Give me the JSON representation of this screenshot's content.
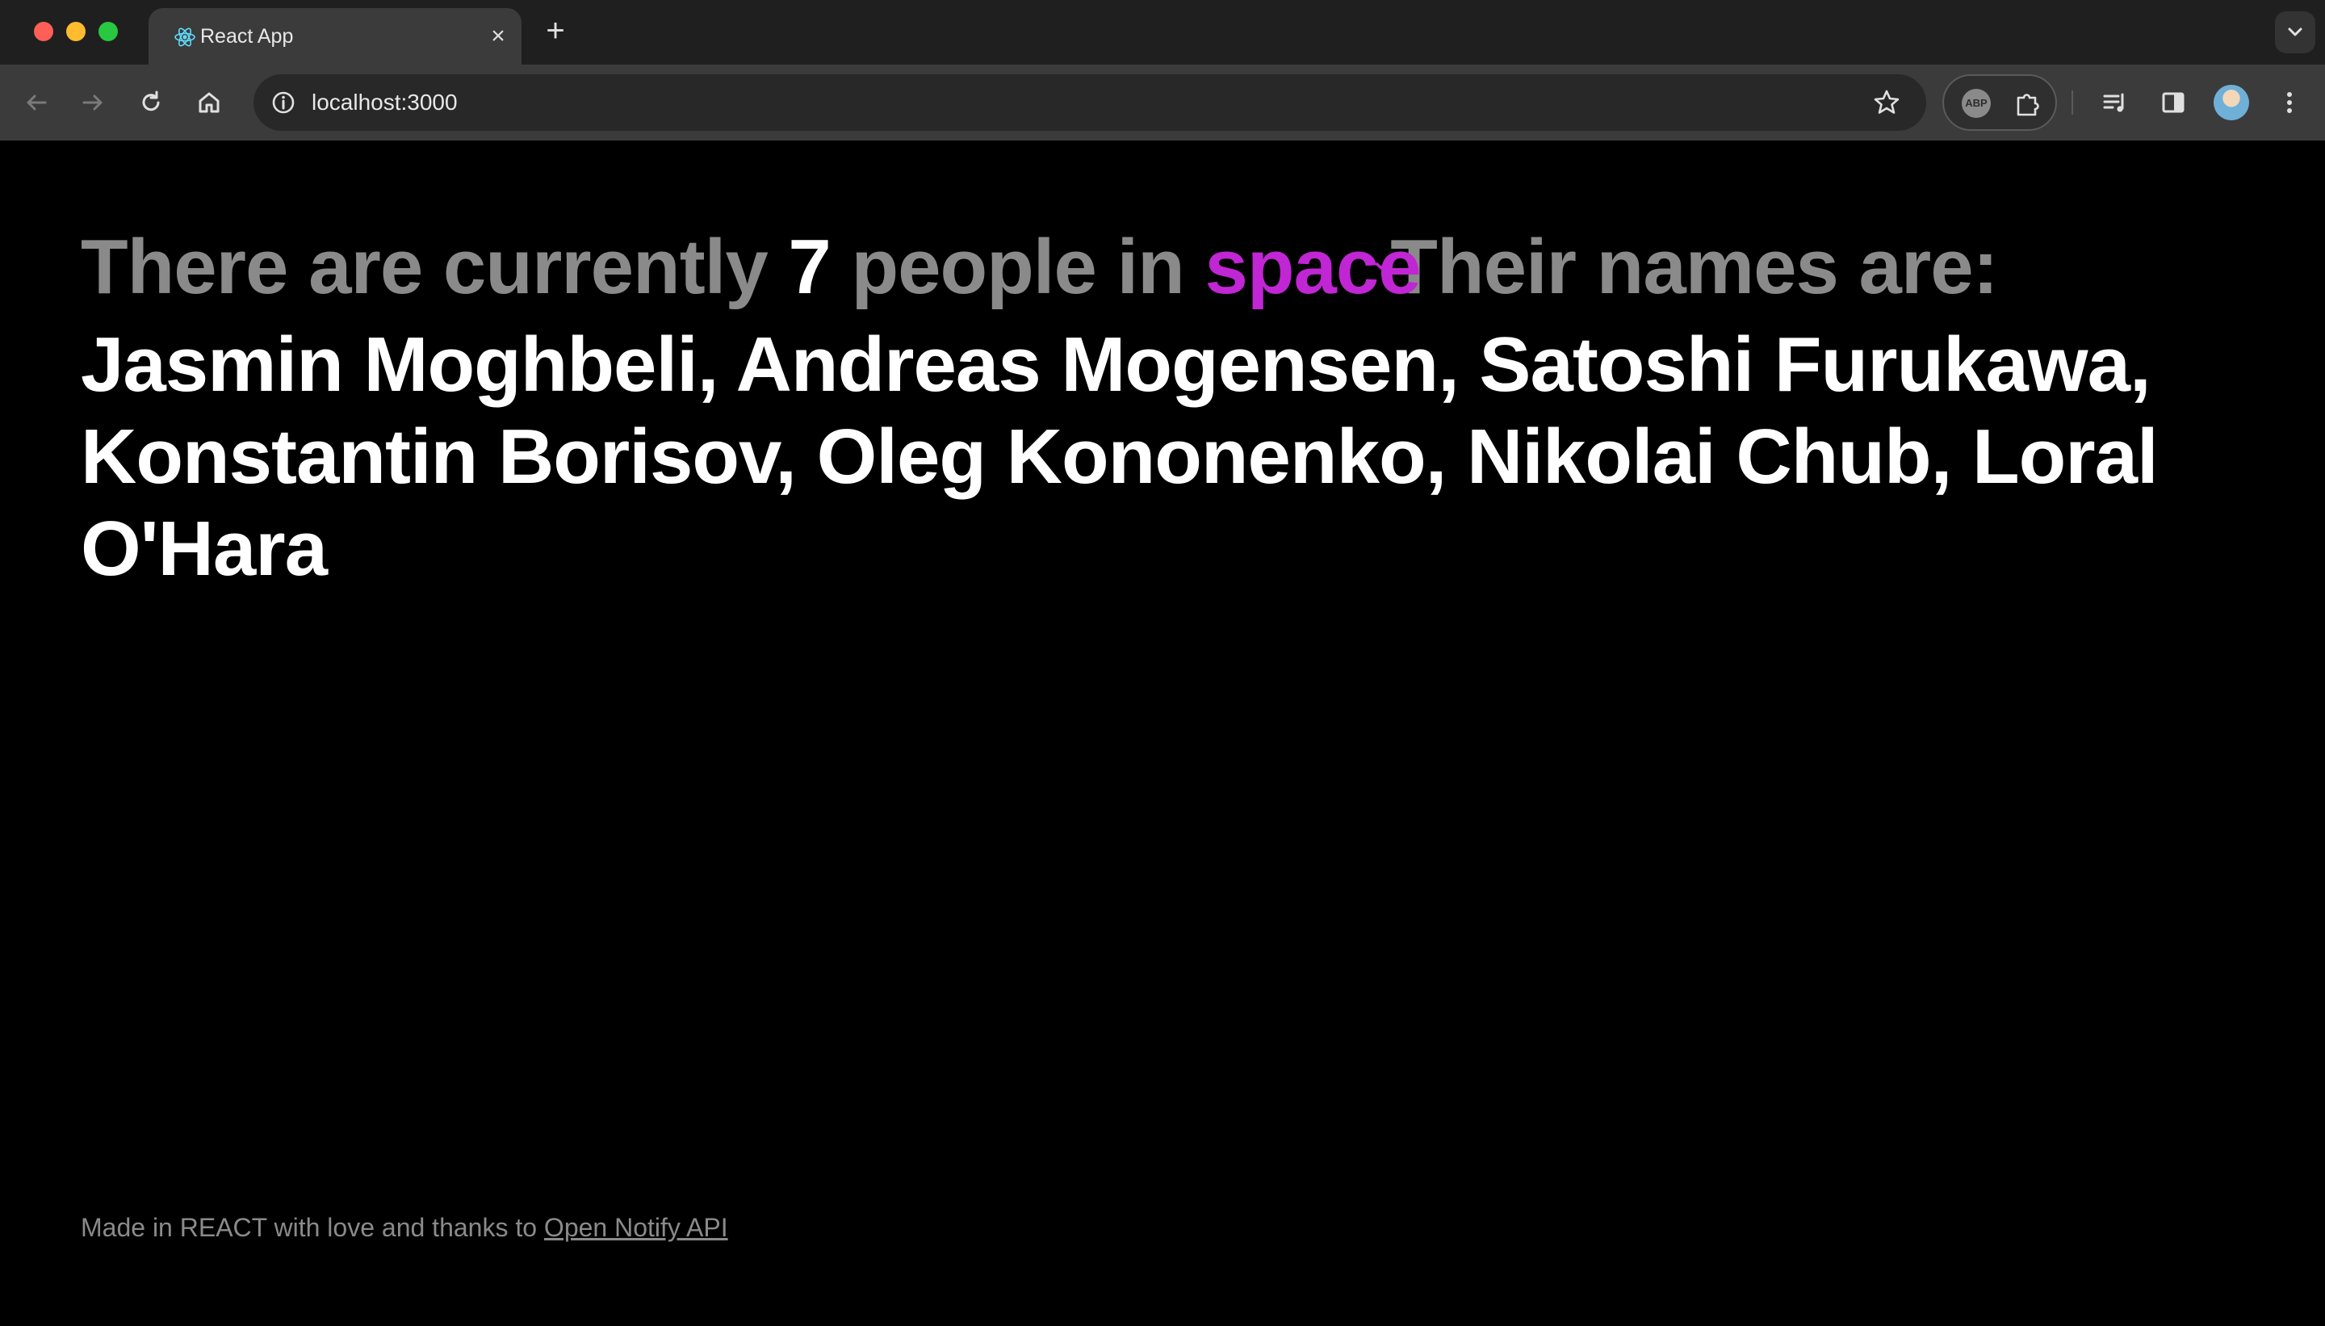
{
  "browser": {
    "tab_title": "React App",
    "tab_close": "×",
    "new_tab": "+",
    "url": "localhost:3000",
    "extension_label": "ABP"
  },
  "page": {
    "prefix": "There are currently",
    "count": "7",
    "middle": "people in",
    "location_selected": "space",
    "suffix": "Their names are:",
    "names": "Jasmin Moghbeli, Andreas Mogensen, Satoshi Furukawa, Konstantin Borisov, Oleg Kononenko, Nikolai Chub, Loral O'Hara"
  },
  "footer": {
    "text": "Made in REACT with love and thanks to",
    "link_text": "Open Notify API"
  },
  "colors": {
    "background": "#000000",
    "muted_text": "#8a8a8a",
    "accent": "#c026d3",
    "chrome_dark": "#1f1f1f",
    "chrome_toolbar": "#3b3b3b"
  }
}
